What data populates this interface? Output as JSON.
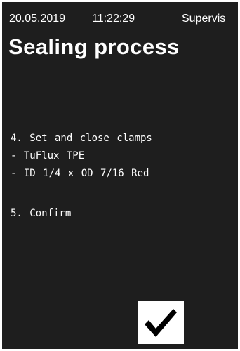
{
  "status_bar": {
    "date": "20.05.2019",
    "time": "11:22:29",
    "user": "Supervis"
  },
  "page_title": "Sealing process",
  "instructions": {
    "step4": "4. Set and close clamps",
    "tubing_name": "- TuFlux TPE",
    "tubing_size": "- ID 1/4 x OD 7/16 Red",
    "step5": "5. Confirm"
  },
  "icons": {
    "confirm": "checkmark-icon"
  },
  "colors": {
    "screen_background": "#1e1e1e",
    "text": "#ffffff",
    "confirm_button_background": "#ffffff",
    "checkmark": "#000000"
  }
}
